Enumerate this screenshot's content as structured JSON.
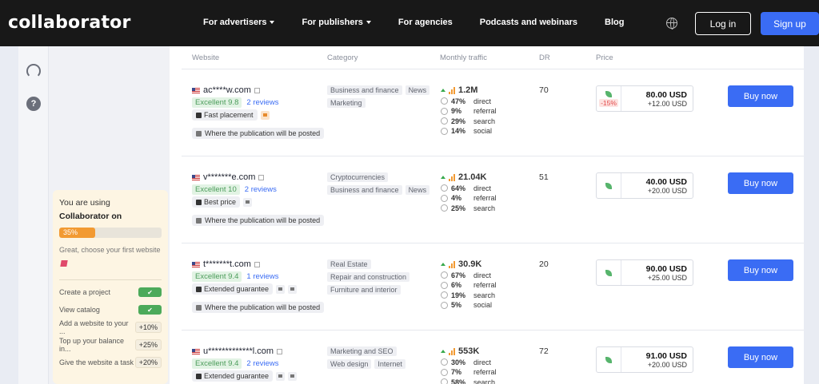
{
  "header": {
    "logo": "collaborator",
    "nav": [
      {
        "label": "For advertisers",
        "dropdown": true
      },
      {
        "label": "For publishers",
        "dropdown": true
      },
      {
        "label": "For agencies",
        "dropdown": false
      },
      {
        "label": "Podcasts and webinars",
        "dropdown": false
      },
      {
        "label": "Blog",
        "dropdown": false
      }
    ],
    "login": "Log in",
    "signup": "Sign up"
  },
  "rail": {
    "help_icon": "?"
  },
  "onboarding": {
    "line1": "You are using",
    "line2": "Collaborator on",
    "progress": 0.35,
    "progress_label": "35%",
    "hint": "Great, choose your first website",
    "tasks": [
      {
        "label": "Create a project",
        "status": "done"
      },
      {
        "label": "View catalog",
        "status": "done"
      },
      {
        "label": "Add a website to your ...",
        "bonus": "+10%"
      },
      {
        "label": "Top up your balance in...",
        "bonus": "+25%"
      },
      {
        "label": "Give the website a task",
        "bonus": "+20%"
      }
    ],
    "done_mark": "✔"
  },
  "table": {
    "columns": [
      "Website",
      "Category",
      "Monthly traffic",
      "DR",
      "Price"
    ],
    "buy_label": "Buy now",
    "pub_label": "Where the publication will be posted",
    "traffic_labels": {
      "direct": "direct",
      "referral": "referral",
      "search": "search",
      "social": "social"
    },
    "rows": [
      {
        "site": "ac****w.com",
        "rating": "Excellent 9.8",
        "reviews": "2 reviews",
        "badge": "Fast placement",
        "extra_icons": [
          "chat-orange"
        ],
        "categories": [
          "Business and finance",
          "News",
          "Marketing"
        ],
        "traffic_total": "1.2M",
        "traffic": [
          [
            "47%",
            "direct"
          ],
          [
            "9%",
            "referral"
          ],
          [
            "29%",
            "search"
          ],
          [
            "14%",
            "social"
          ]
        ],
        "dr": "70",
        "discount": "-15%",
        "price": "80.00 USD",
        "price_extra": "+12.00 USD"
      },
      {
        "site": "v*******e.com",
        "rating": "Excellent 10",
        "reviews": "2 reviews",
        "badge": "Best price",
        "extra_icons": [
          "chat"
        ],
        "categories": [
          "Cryptocurrencies",
          "Business and finance",
          "News"
        ],
        "traffic_total": "21.04K",
        "traffic": [
          [
            "64%",
            "direct"
          ],
          [
            "4%",
            "referral"
          ],
          [
            "25%",
            "search"
          ]
        ],
        "dr": "51",
        "discount": "",
        "price": "40.00 USD",
        "price_extra": "+20.00 USD"
      },
      {
        "site": "t*******t.com",
        "rating": "Excellent 9.4",
        "reviews": "1 reviews",
        "badge": "Extended guarantee",
        "extra_icons": [
          "doc",
          "chat"
        ],
        "categories": [
          "Real Estate",
          "Repair and construction",
          "Furniture and interior"
        ],
        "traffic_total": "30.9K",
        "traffic": [
          [
            "67%",
            "direct"
          ],
          [
            "6%",
            "referral"
          ],
          [
            "19%",
            "search"
          ],
          [
            "5%",
            "social"
          ]
        ],
        "dr": "20",
        "discount": "",
        "price": "90.00 USD",
        "price_extra": "+25.00 USD"
      },
      {
        "site": "u*************l.com",
        "rating": "Excellent 9.4",
        "reviews": "2 reviews",
        "badge": "Extended guarantee",
        "extra_icons": [
          "people",
          "chat"
        ],
        "categories": [
          "Marketing and SEO",
          "Web design",
          "Internet"
        ],
        "traffic_total": "553K",
        "traffic": [
          [
            "30%",
            "direct"
          ],
          [
            "7%",
            "referral"
          ],
          [
            "58%",
            "search"
          ]
        ],
        "dr": "72",
        "discount": "",
        "price": "91.00 USD",
        "price_extra": "+20.00 USD"
      }
    ]
  }
}
